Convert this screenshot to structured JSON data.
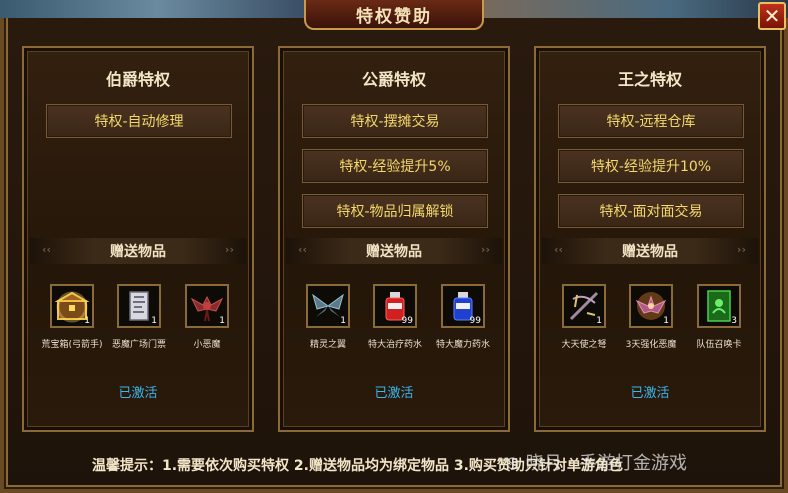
{
  "window": {
    "title": "特权赞助",
    "close_label": "✕"
  },
  "panels": [
    {
      "title": "伯爵特权",
      "privileges": [
        "特权-自动修理"
      ],
      "gift_label": "赠送物品",
      "items": [
        {
          "name": "荒宝箱(弓箭手)",
          "count": "1",
          "icon": "treasure-chest-icon"
        },
        {
          "name": "恶魔广场门票",
          "count": "1",
          "icon": "ticket-scroll-icon"
        },
        {
          "name": "小恶魔",
          "count": "1",
          "icon": "imp-pet-icon"
        }
      ],
      "status": "已激活"
    },
    {
      "title": "公爵特权",
      "privileges": [
        "特权-摆摊交易",
        "特权-经验提升5%",
        "特权-物品归属解锁"
      ],
      "gift_label": "赠送物品",
      "items": [
        {
          "name": "精灵之翼",
          "count": "1",
          "icon": "elf-wings-icon"
        },
        {
          "name": "特大治疗药水",
          "count": "99",
          "icon": "red-potion-icon"
        },
        {
          "name": "特大魔力药水",
          "count": "99",
          "icon": "blue-potion-icon"
        }
      ],
      "status": "已激活"
    },
    {
      "title": "王之特权",
      "privileges": [
        "特权-远程仓库",
        "特权-经验提升10%",
        "特权-面对面交易"
      ],
      "gift_label": "赠送物品",
      "items": [
        {
          "name": "大天使之弩",
          "count": "1",
          "icon": "crossbow-icon"
        },
        {
          "name": "3天强化恶魔",
          "count": "1",
          "icon": "demon-pet-icon"
        },
        {
          "name": "队伍召唤卡",
          "count": "3",
          "icon": "summon-card-icon"
        }
      ],
      "status": "已激活"
    }
  ],
  "footer": {
    "tip": "温馨提示：1.需要依次购买特权 2.赠送物品均为绑定物品 3.购买赞助只针对单游角色",
    "watermark": "⊛ 晓月 · 手游打金游戏"
  },
  "colors": {
    "gold_text": "#f4d86a",
    "active_status": "#39b6f0",
    "border_gold": "#8a6a38"
  }
}
